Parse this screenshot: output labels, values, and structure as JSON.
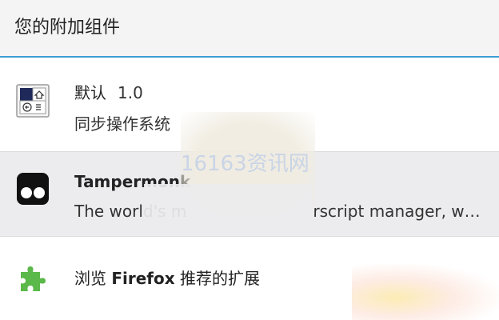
{
  "header": {
    "title": "您的附加组件"
  },
  "addons": [
    {
      "name": "默认",
      "version": "1.0",
      "description": "同步操作系统"
    },
    {
      "name": "Tampermonk",
      "description_start": "The world's m",
      "description_end": "rscript manager, wit…"
    }
  ],
  "browse": {
    "prefix": "浏览 ",
    "brand": "Firefox",
    "suffix": " 推荐的扩展"
  },
  "watermark": {
    "text": "16163资讯网"
  },
  "colors": {
    "accent_line": "#3b9fd8",
    "header_bg": "#f4f4f5",
    "selected_row_bg": "#ececee",
    "puzzle_green": "#5bb84a"
  },
  "icons": {
    "default_theme": "default-theme-icon",
    "tampermonkey": "tampermonkey-icon",
    "browse_extensions": "puzzle-piece-icon"
  }
}
